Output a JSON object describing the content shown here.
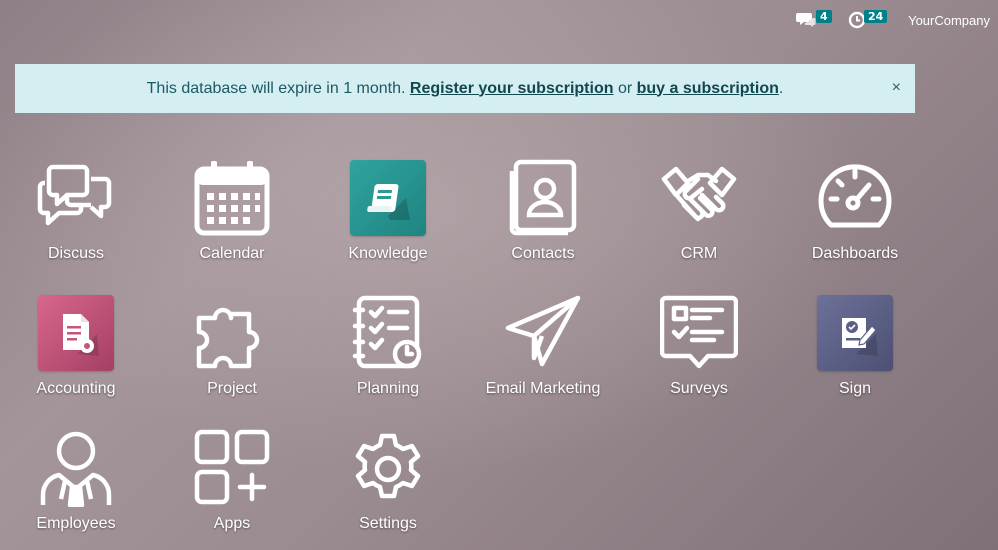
{
  "systray": {
    "messages_count": "4",
    "activities_count": "24",
    "company_name": "YourCompany"
  },
  "banner": {
    "text_before": "This database will expire in 1 month. ",
    "register_link": "Register your subscription",
    "text_middle": " or ",
    "buy_link": "buy a subscription",
    "text_after": ".",
    "close_glyph": "×",
    "background": "#d5eef2"
  },
  "apps": [
    {
      "label": "Discuss",
      "icon": "chat-bubbles-icon"
    },
    {
      "label": "Calendar",
      "icon": "calendar-icon"
    },
    {
      "label": "Knowledge",
      "icon": "book-icon",
      "color": "#2b9a94"
    },
    {
      "label": "Contacts",
      "icon": "contact-card-icon"
    },
    {
      "label": "CRM",
      "icon": "handshake-icon"
    },
    {
      "label": "Dashboards",
      "icon": "gauge-icon"
    },
    {
      "label": "Accounting",
      "icon": "document-gear-icon",
      "color": "#c4567a"
    },
    {
      "label": "Project",
      "icon": "puzzle-icon"
    },
    {
      "label": "Planning",
      "icon": "checklist-clock-icon"
    },
    {
      "label": "Email Marketing",
      "icon": "paper-plane-icon"
    },
    {
      "label": "Surveys",
      "icon": "survey-bubble-icon"
    },
    {
      "label": "Sign",
      "icon": "sign-document-icon",
      "color": "#5b5f86"
    },
    {
      "label": "Employees",
      "icon": "employee-icon"
    },
    {
      "label": "Apps",
      "icon": "apps-grid-icon"
    },
    {
      "label": "Settings",
      "icon": "gear-icon"
    }
  ]
}
